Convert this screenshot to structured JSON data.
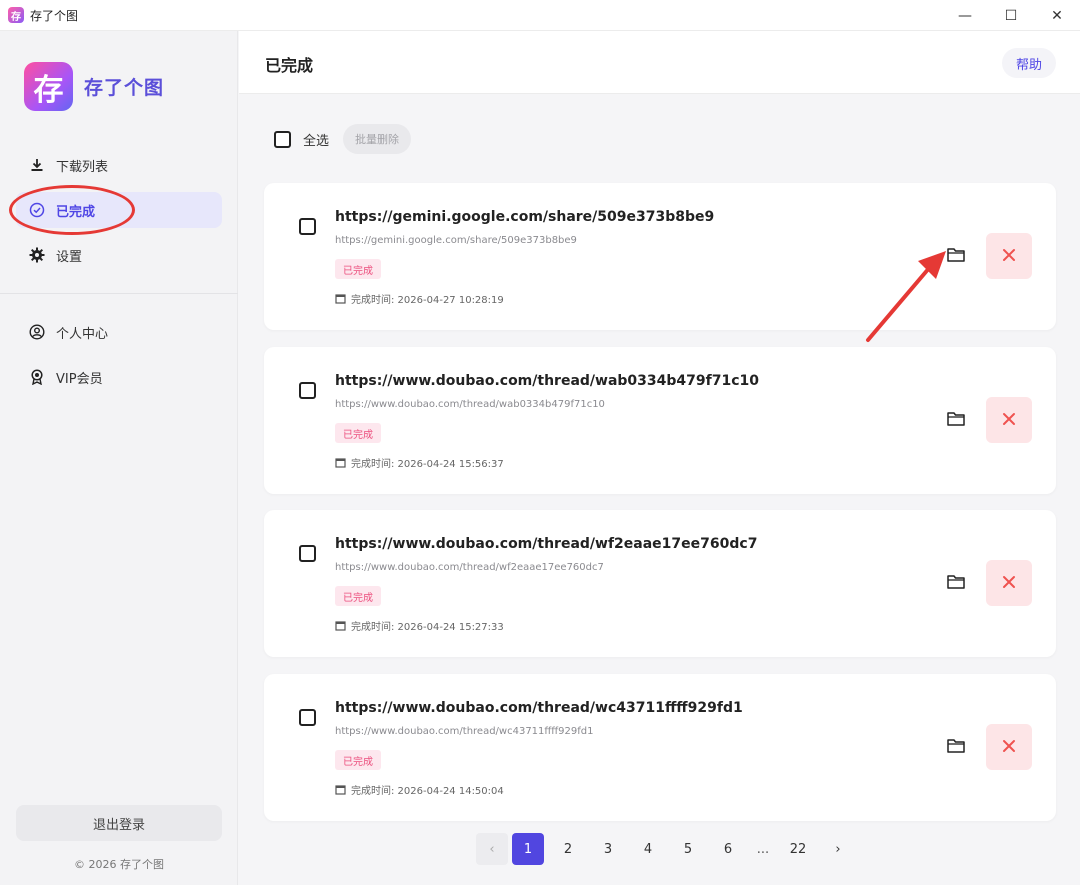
{
  "window": {
    "title": "存了个图",
    "logo_glyph": "存",
    "controls": [
      "—",
      "☐",
      "✕"
    ]
  },
  "sidebar": {
    "brand_name": "存了个图",
    "brand_glyph": "存",
    "items": [
      {
        "label": "下载列表",
        "icon": "download-icon"
      },
      {
        "label": "已完成",
        "icon": "check-circle-icon",
        "active": true
      },
      {
        "label": "设置",
        "icon": "gear-icon"
      },
      {
        "label": "个人中心",
        "icon": "user-circle-icon"
      },
      {
        "label": "VIP会员",
        "icon": "vip-badge-icon"
      }
    ],
    "logout_label": "退出登录",
    "copyright": "© 2026 存了个图"
  },
  "header": {
    "title": "已完成",
    "help_label": "帮助"
  },
  "toolbar": {
    "select_all_label": "全选",
    "bulk_delete_label": "批量删除"
  },
  "records": [
    {
      "title": "https://gemini.google.com/share/509e373b8be9",
      "url": "https://gemini.google.com/share/509e373b8be9",
      "status": "已完成",
      "time": "完成时间: 2026-04-27 10:28:19"
    },
    {
      "title": "https://www.doubao.com/thread/wab0334b479f71c10",
      "url": "https://www.doubao.com/thread/wab0334b479f71c10",
      "status": "已完成",
      "time": "完成时间: 2026-04-24 15:56:37"
    },
    {
      "title": "https://www.doubao.com/thread/wf2eaae17ee760dc7",
      "url": "https://www.doubao.com/thread/wf2eaae17ee760dc7",
      "status": "已完成",
      "time": "完成时间: 2026-04-24 15:27:33"
    },
    {
      "title": "https://www.doubao.com/thread/wc43711ffff929fd1",
      "url": "https://www.doubao.com/thread/wc43711ffff929fd1",
      "status": "已完成",
      "time": "完成时间: 2026-04-24 14:50:04"
    }
  ],
  "pagination": {
    "prev": "‹",
    "pages": [
      "1",
      "2",
      "3",
      "4",
      "5",
      "6"
    ],
    "ellipsis": "...",
    "last": "22",
    "next": "›",
    "current": 1
  },
  "colors": {
    "accent": "#5146e0",
    "brand": "#5b4fd9",
    "badge_text": "#ec4f7e",
    "badge_bg": "#fde7ee",
    "delete_bg": "#fde5e7",
    "delete_icon": "#ef5350",
    "annotation": "#e53935"
  }
}
